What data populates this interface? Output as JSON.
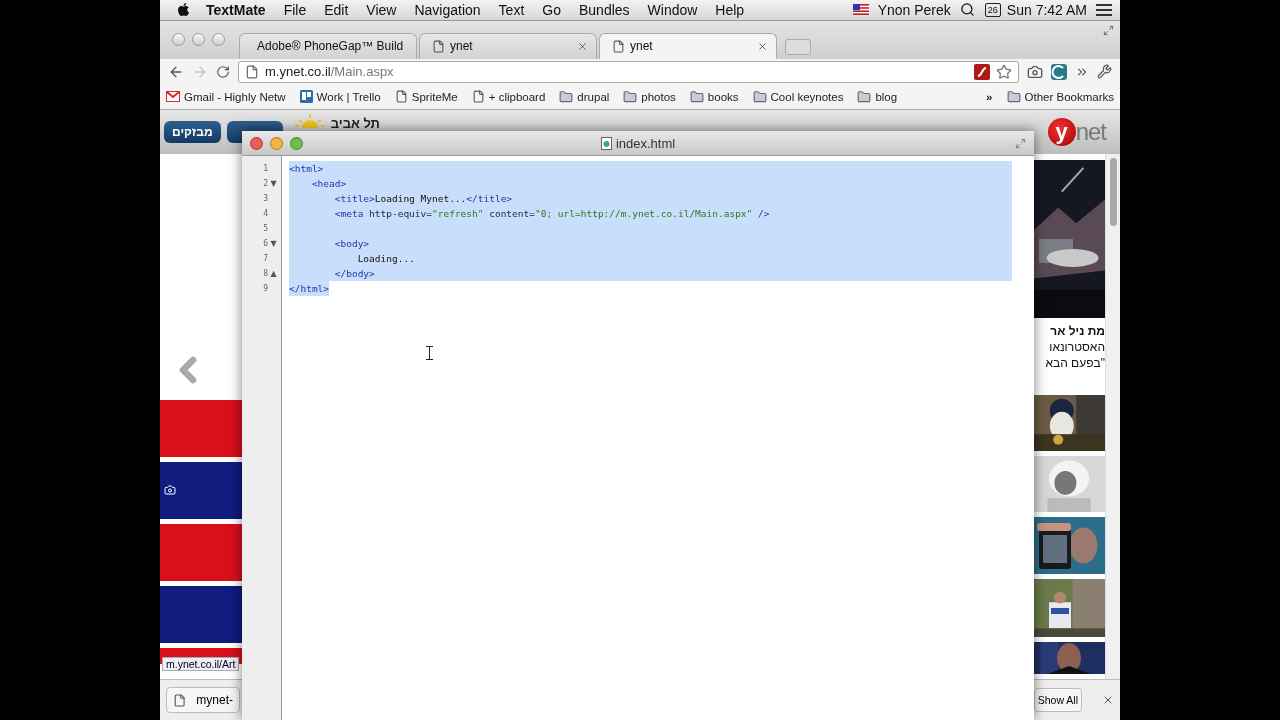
{
  "menu_bar": {
    "app": "TextMate",
    "menus": [
      "File",
      "Edit",
      "View",
      "Navigation",
      "Text",
      "Go",
      "Bundles",
      "Window",
      "Help"
    ],
    "user": "Ynon Perek",
    "date_badge": "26",
    "clock": "Sun 7:42 AM"
  },
  "browser": {
    "tabs": [
      {
        "title": "Adobe® PhoneGap™ Build",
        "kind": "app",
        "selected": false
      },
      {
        "title": "ynet",
        "kind": "page",
        "selected": false
      },
      {
        "title": "ynet",
        "kind": "page",
        "selected": true
      }
    ],
    "forward_disabled": true,
    "address": {
      "host": "m.ynet.co.il",
      "path": "/Main.aspx"
    },
    "bookmarks": [
      {
        "label": "Gmail - Highly Netw",
        "kind": "gmail"
      },
      {
        "label": "Work | Trello",
        "kind": "trello"
      },
      {
        "label": "SpriteMe",
        "kind": "page"
      },
      {
        "label": "+ clipboard",
        "kind": "page"
      },
      {
        "label": "drupal",
        "kind": "folder"
      },
      {
        "label": "photos",
        "kind": "folder"
      },
      {
        "label": "books",
        "kind": "folder"
      },
      {
        "label": "Cool keynotes",
        "kind": "folder"
      },
      {
        "label": "blog",
        "kind": "folder"
      }
    ],
    "overflow": "»",
    "other_bookmarks": "Other Bookmarks"
  },
  "page": {
    "header_button": "מבזקים",
    "city": "תל אביב",
    "logo": {
      "mark": "y",
      "word": "net"
    },
    "headline_lines": [
      "מת ניל אר",
      "האסטרונאו",
      "\"בפעם הבא"
    ],
    "promo_blocks": [
      {
        "color": "#d8101a"
      },
      {
        "color": "#101c7e"
      },
      {
        "color": "#d8101a"
      },
      {
        "color": "#101c7e"
      },
      {
        "color": "#d8101a"
      }
    ],
    "status_url": "m.ynet.co.il/Art"
  },
  "downloads": {
    "items": [
      {
        "name": "mynet-"
      }
    ],
    "show_all": "Show All"
  },
  "editor": {
    "title": "index.html",
    "lines": [
      {
        "number": "1",
        "selected": true,
        "newline_selected": true,
        "tokens": [
          {
            "text": "<html>",
            "kind": "tag"
          }
        ]
      },
      {
        "number": "2",
        "fold_marker": "▼",
        "selected": true,
        "newline_selected": true,
        "tokens": [
          {
            "text": "    <head>",
            "kind": "tag"
          }
        ]
      },
      {
        "number": "3",
        "selected": true,
        "newline_selected": true,
        "tokens": [
          {
            "text": "        <title>",
            "kind": "tag"
          },
          {
            "text": "Loading Mynet...",
            "kind": "text"
          },
          {
            "text": "</title>",
            "kind": "tag"
          }
        ]
      },
      {
        "number": "4",
        "selected": true,
        "newline_selected": true,
        "tokens": [
          {
            "text": "        <meta",
            "kind": "tag"
          },
          {
            "text": " http-equiv=",
            "kind": "attr"
          },
          {
            "text": "\"refresh\"",
            "kind": "string"
          },
          {
            "text": " content=",
            "kind": "attr"
          },
          {
            "text": "\"0; url=http://m.ynet.co.il/Main.aspx\"",
            "kind": "string"
          },
          {
            "text": " />",
            "kind": "tag"
          }
        ]
      },
      {
        "number": "5",
        "selected": true,
        "newline_selected": true
      },
      {
        "number": "6",
        "fold_marker": "▼",
        "selected": true,
        "newline_selected": true,
        "tokens": [
          {
            "text": "        <body>",
            "kind": "tag"
          }
        ]
      },
      {
        "number": "7",
        "selected": true,
        "newline_selected": true,
        "tokens": [
          {
            "text": "            Loading...",
            "kind": "text"
          }
        ]
      },
      {
        "number": "8",
        "fold_marker": "▲",
        "selected": true,
        "newline_selected": true,
        "tokens": [
          {
            "text": "        </body>",
            "kind": "tag"
          }
        ]
      },
      {
        "number": "9",
        "selected": true,
        "newline_selected": false,
        "tokens": [
          {
            "text": "</html>",
            "kind": "tag"
          }
        ]
      }
    ]
  }
}
